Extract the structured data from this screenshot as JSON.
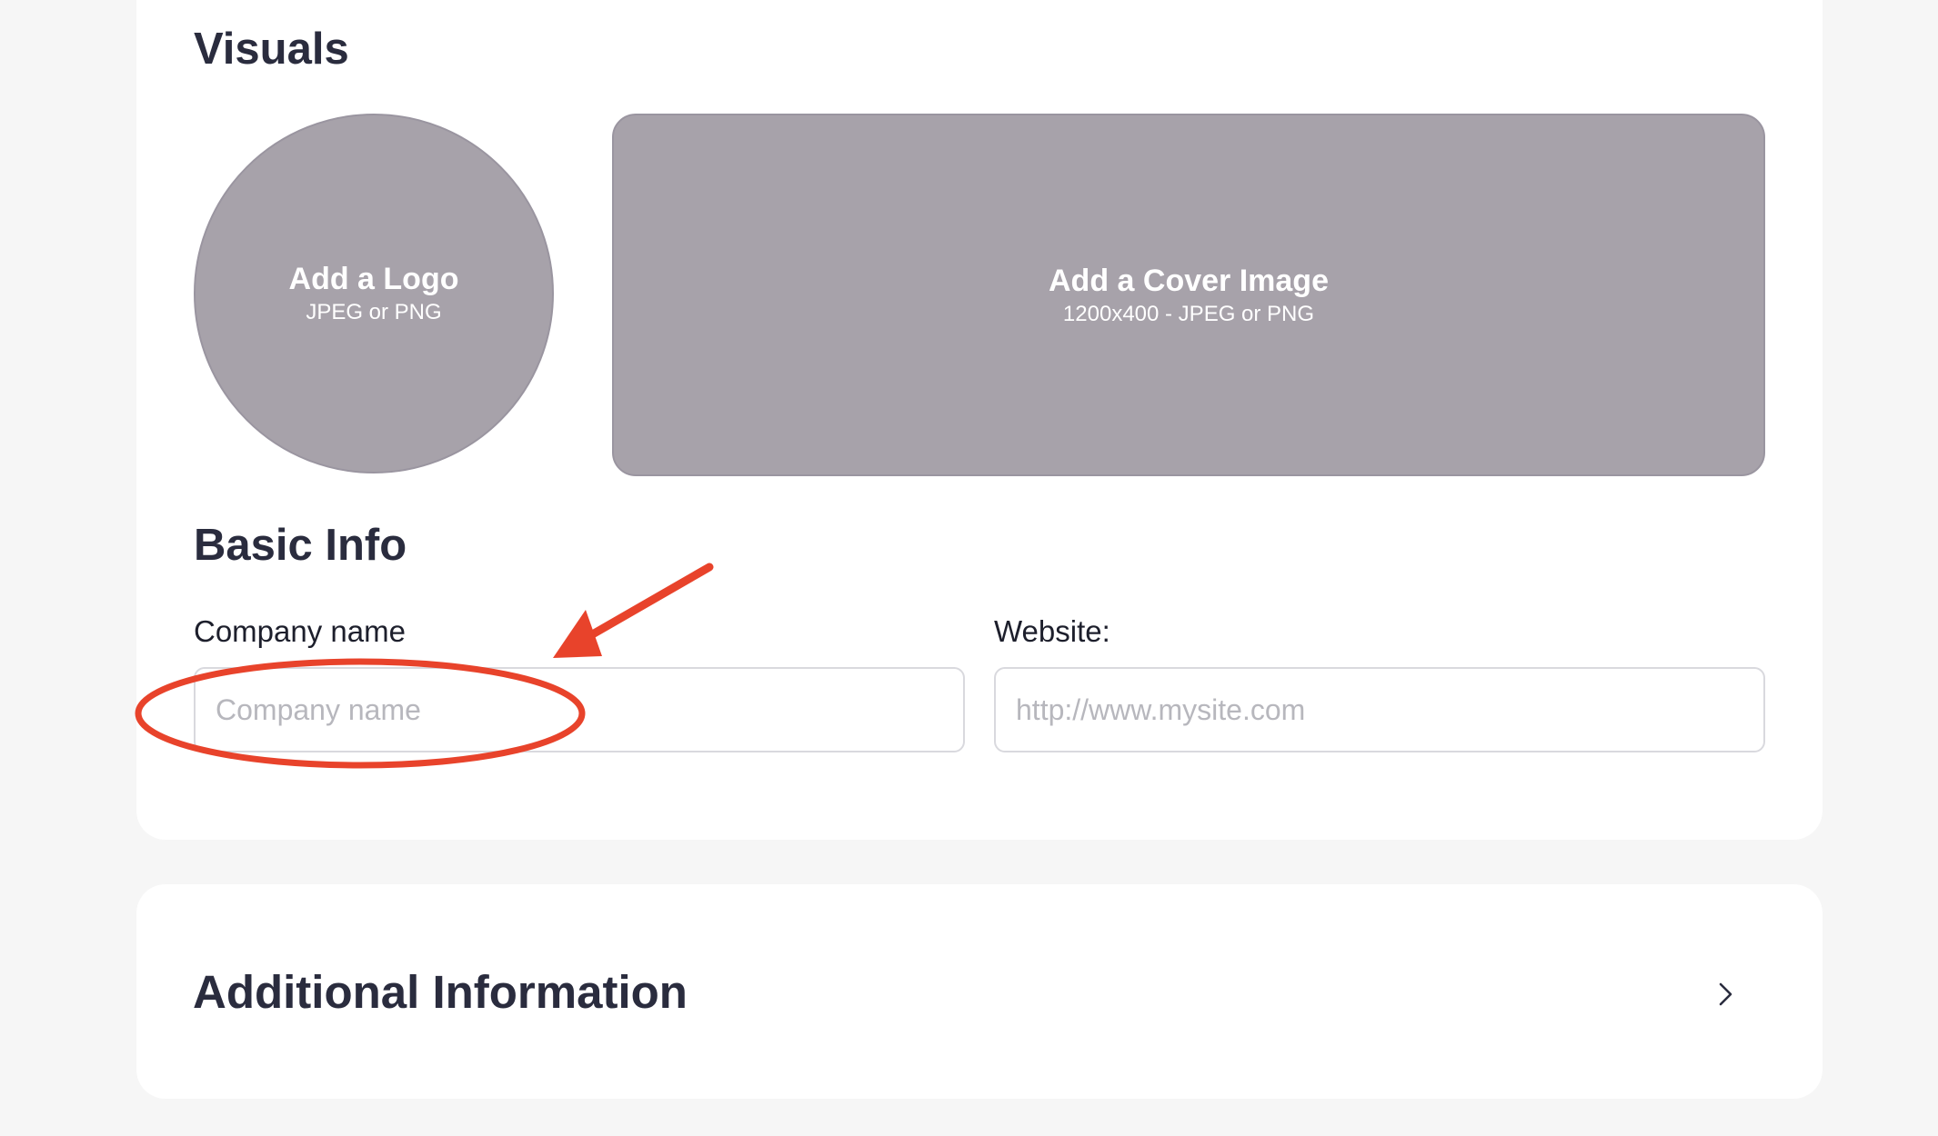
{
  "visuals": {
    "title": "Visuals",
    "logo": {
      "title": "Add a Logo",
      "subtitle": "JPEG or PNG"
    },
    "cover": {
      "title": "Add a Cover Image",
      "subtitle": "1200x400 - JPEG or PNG"
    }
  },
  "basic_info": {
    "title": "Basic Info",
    "company_name": {
      "label": "Company name",
      "placeholder": "Company name",
      "value": ""
    },
    "website": {
      "label": "Website:",
      "placeholder": "http://www.mysite.com",
      "value": ""
    }
  },
  "additional_information": {
    "title": "Additional Information",
    "icon": "chevron-right-icon"
  },
  "annotation": {
    "color": "#e8432b",
    "shapes": [
      "arrow",
      "ellipse"
    ]
  },
  "colors": {
    "background": "#f6f6f6",
    "card": "#ffffff",
    "placeholder_fill": "#a7a2aa",
    "heading": "#2a2c3e",
    "annotation": "#e8432b"
  }
}
